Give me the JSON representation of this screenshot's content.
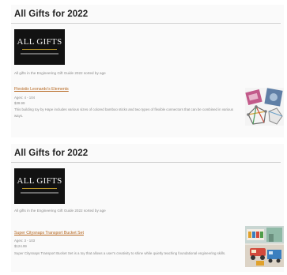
{
  "cards": [
    {
      "title": "All Gifts for 2022",
      "banner_text": "ALL GIFTS",
      "intro": "All gifts in the Engineering Gift Guide 2022 sorted by age",
      "item": {
        "name": "Flexistix Leonardo's Elements",
        "ages": "Ages: 4 - 104",
        "price": "$39.99",
        "description": "This building toy by Hape includes various sizes of colored bamboo sticks and two types of flexible connectors that can be combined in various ways.",
        "image_icon": "flexistix-product-photo"
      }
    },
    {
      "title": "All Gifts for 2022",
      "banner_text": "ALL GIFTS",
      "intro": "All gifts in the Engineering Gift Guide 2022 sorted by age",
      "item": {
        "name": "Super Citysnaps Transport Bucket Set",
        "ages": "Ages: 3 - 103",
        "price": "$124.99",
        "description": "Super Citysnaps Transport Bucket Set is a toy that allows a user's creativity to shine while quietly teaching foundational engineering skills.",
        "image_icon": "citysnaps-product-photo"
      }
    }
  ],
  "colors": {
    "link": "#b5651d",
    "muted_text": "#8a8a8a",
    "banner_bg": "#121212",
    "banner_accent": "#b9962a"
  }
}
